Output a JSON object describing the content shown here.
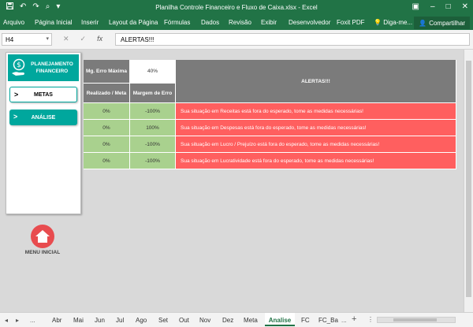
{
  "window": {
    "title": "Planilha Controle Financeiro e Fluxo de Caixa.xlsx - Excel"
  },
  "ribbon": {
    "tabs": [
      "Arquivo",
      "Página Inicial",
      "Inserir",
      "Layout da Página",
      "Fórmulas",
      "Dados",
      "Revisão",
      "Exibir",
      "Desenvolvedor",
      "Foxit PDF",
      "Diga-me..."
    ],
    "share": "Compartilhar"
  },
  "formula_bar": {
    "name_box": "H4",
    "fx": "fx",
    "content": "ALERTAS!!!"
  },
  "sidebar": {
    "logo_text": "PLANEJAMENTO FINANCEIRO",
    "metas": "METAS",
    "analise": "ANÁLISE",
    "arrow": ">",
    "menu_inicial": "MENU INICIAL"
  },
  "analysis": {
    "mg_label": "Mg. Erro Máxima",
    "mg_value": "40%",
    "alerts_header": "ALERTAS!!!",
    "col_realizado": "Realizado / Meta",
    "col_margem": "Margem de Erro",
    "rows": [
      {
        "realizado": "0%",
        "margem": "-100%",
        "alerta": "Sua situação em Receitas está fora do esperado, tome as medidas necessárias!"
      },
      {
        "realizado": "0%",
        "margem": "100%",
        "alerta": "Sua situação em Despesas está fora do esperado, tome as medidas necessárias!"
      },
      {
        "realizado": "0%",
        "margem": "-100%",
        "alerta": "Sua situação em Lucro / Prejuízo está fora do esperado, tome as medidas necessárias!"
      },
      {
        "realizado": "0%",
        "margem": "-100%",
        "alerta": "Sua situação em Lucratividade está fora do esperado, tome as medidas necessárias!"
      }
    ]
  },
  "sheet_tabs": {
    "nav": [
      "◂",
      "▸",
      "..."
    ],
    "tabs": [
      "Abr",
      "Mai",
      "Jun",
      "Jul",
      "Ago",
      "Set",
      "Out",
      "Nov",
      "Dez",
      "Meta",
      "Analise",
      "FC",
      "FC_Ba"
    ],
    "active": "Analise",
    "more": "...",
    "add": "+"
  },
  "colors": {
    "excel_green": "#217346",
    "teal": "#00a79d",
    "alert_red": "#ff5f5f",
    "ok_green": "#a9d18e",
    "header_gray": "#7b7b7b",
    "home_red": "#e84c4f"
  }
}
